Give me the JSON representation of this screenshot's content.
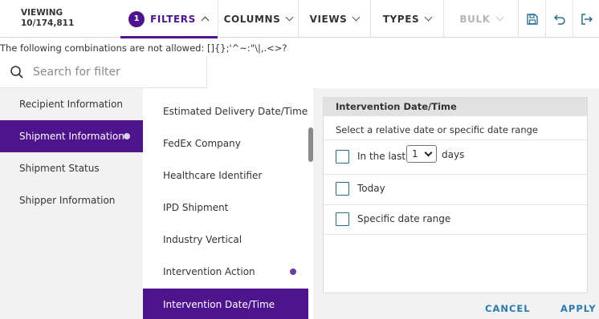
{
  "toolbar": {
    "viewing_label": "VIEWING",
    "viewing_count": "10/174,811",
    "filters_badge": "1",
    "filters_label": "FILTERS",
    "columns_label": "COLUMNS",
    "views_label": "VIEWS",
    "types_label": "TYPES",
    "bulk_label": "BULK",
    "icons": [
      "save-icon",
      "undo-icon",
      "exit-icon"
    ]
  },
  "notice": "The following combinations are not allowed: []{};'^~:\"\\|,.<>?",
  "search": {
    "placeholder": "Search for filter",
    "value": ""
  },
  "categories": [
    {
      "label": "Recipient Information",
      "active": false
    },
    {
      "label": "Shipment Information",
      "active": true
    },
    {
      "label": "Shipment Status",
      "active": false
    },
    {
      "label": "Shipper Information",
      "active": false
    }
  ],
  "fields": [
    {
      "label": "Estimated Delivery Date/Time",
      "active": false,
      "has_filter": false
    },
    {
      "label": "FedEx Company",
      "active": false,
      "has_filter": false
    },
    {
      "label": "Healthcare Identifier",
      "active": false,
      "has_filter": false
    },
    {
      "label": "IPD Shipment",
      "active": false,
      "has_filter": false
    },
    {
      "label": "Industry Vertical",
      "active": false,
      "has_filter": false
    },
    {
      "label": "Intervention Action",
      "active": false,
      "has_filter": true
    },
    {
      "label": "Intervention Date/Time",
      "active": true,
      "has_filter": false
    }
  ],
  "panel": {
    "title": "Intervention Date/Time",
    "subtitle": "Select a relative date or specific date range",
    "option_in_last": "In the last",
    "in_last_value": "1",
    "days_label": "days",
    "option_today": "Today",
    "option_range": "Specific date range"
  },
  "actions": {
    "cancel": "CANCEL",
    "apply": "APPLY"
  },
  "colors": {
    "accent": "#4d148c",
    "link": "#2a7ab0",
    "checkbox": "#2a6f8e"
  }
}
